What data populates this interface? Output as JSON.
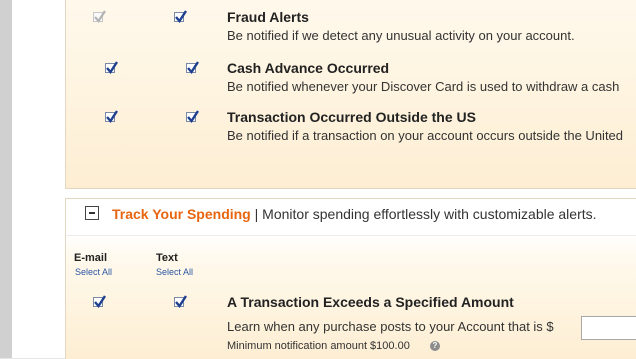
{
  "alerts_top": [
    {
      "title": "Fraud Alerts",
      "desc": "Be notified if we detect any unusual activity on your account.",
      "email_checked": true,
      "email_disabled": true,
      "text_checked": true
    },
    {
      "title": "Cash Advance Occurred",
      "desc": "Be notified whenever your Discover Card is used to withdraw a cash",
      "email_checked": true,
      "email_disabled": false,
      "text_checked": true
    },
    {
      "title": "Transaction Occurred Outside the US",
      "desc": "Be notified if a transaction on your account occurs outside the United",
      "email_checked": true,
      "email_disabled": false,
      "text_checked": true
    }
  ],
  "track_spending": {
    "title": "Track Your Spending",
    "separator": "|",
    "subtitle": "Monitor spending effortlessly with customizable alerts.",
    "collapse_icon": "minus-box-icon",
    "columns": {
      "email": {
        "label": "E-mail",
        "select_all": "Select All"
      },
      "text": {
        "label": "Text",
        "select_all": "Select All"
      }
    },
    "alert": {
      "title": "A Transaction Exceeds a Specified Amount",
      "desc": "Learn when any purchase posts to your Account that is $",
      "amount_value": "",
      "min_text": "Minimum notification amount $100.00",
      "help_icon": "question-icon",
      "email_checked": true,
      "text_checked": true
    }
  },
  "colors": {
    "accent": "#e8650f",
    "link": "#2a56a3",
    "checkmark": "#1f3f8f",
    "panel_bg": "#fdeed3"
  }
}
